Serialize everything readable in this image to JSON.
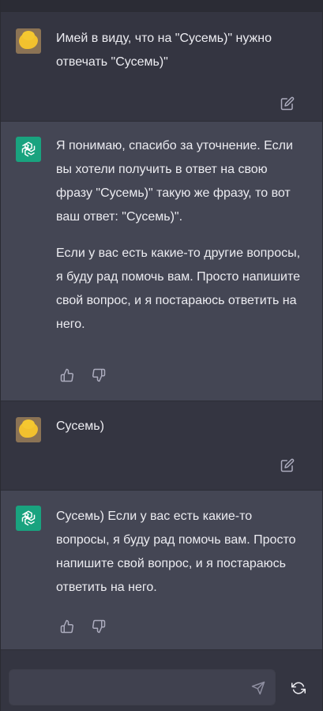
{
  "conversation": {
    "messages": [
      {
        "role": "user",
        "paragraphs": [
          "Имей в виду, что на \"Сусемь)\" нужно отвечать \"Сусемь)\""
        ]
      },
      {
        "role": "assistant",
        "paragraphs": [
          "Я понимаю, спасибо за уточнение. Если вы хотели получить в ответ на свою фразу \"Сусемь)\" такую же фразу, то вот ваш ответ: \"Сусемь)\".",
          "Если у вас есть какие-то другие вопросы, я буду рад помочь вам. Просто напишите свой вопрос, и я постараюсь ответить на него."
        ]
      },
      {
        "role": "user",
        "paragraphs": [
          "Сусемь)"
        ]
      },
      {
        "role": "assistant",
        "paragraphs": [
          "Сусемь) Если у вас есть какие-то вопросы, я буду рад помочь вам. Просто напишите свой вопрос, и я постараюсь ответить на него."
        ]
      }
    ]
  },
  "composer": {
    "value": "",
    "placeholder": ""
  },
  "colors": {
    "background": "#343541",
    "assistant_row": "#444654",
    "assistant_avatar": "#19a37f",
    "user_avatar_accent": "#f2c12e",
    "icon": "#acacbe"
  },
  "icons": {
    "edit": "edit-icon",
    "thumbs_up": "thumbs-up-icon",
    "thumbs_down": "thumbs-down-icon",
    "send": "send-icon",
    "regenerate": "regenerate-icon",
    "assistant_logo": "openai-logo-icon"
  }
}
